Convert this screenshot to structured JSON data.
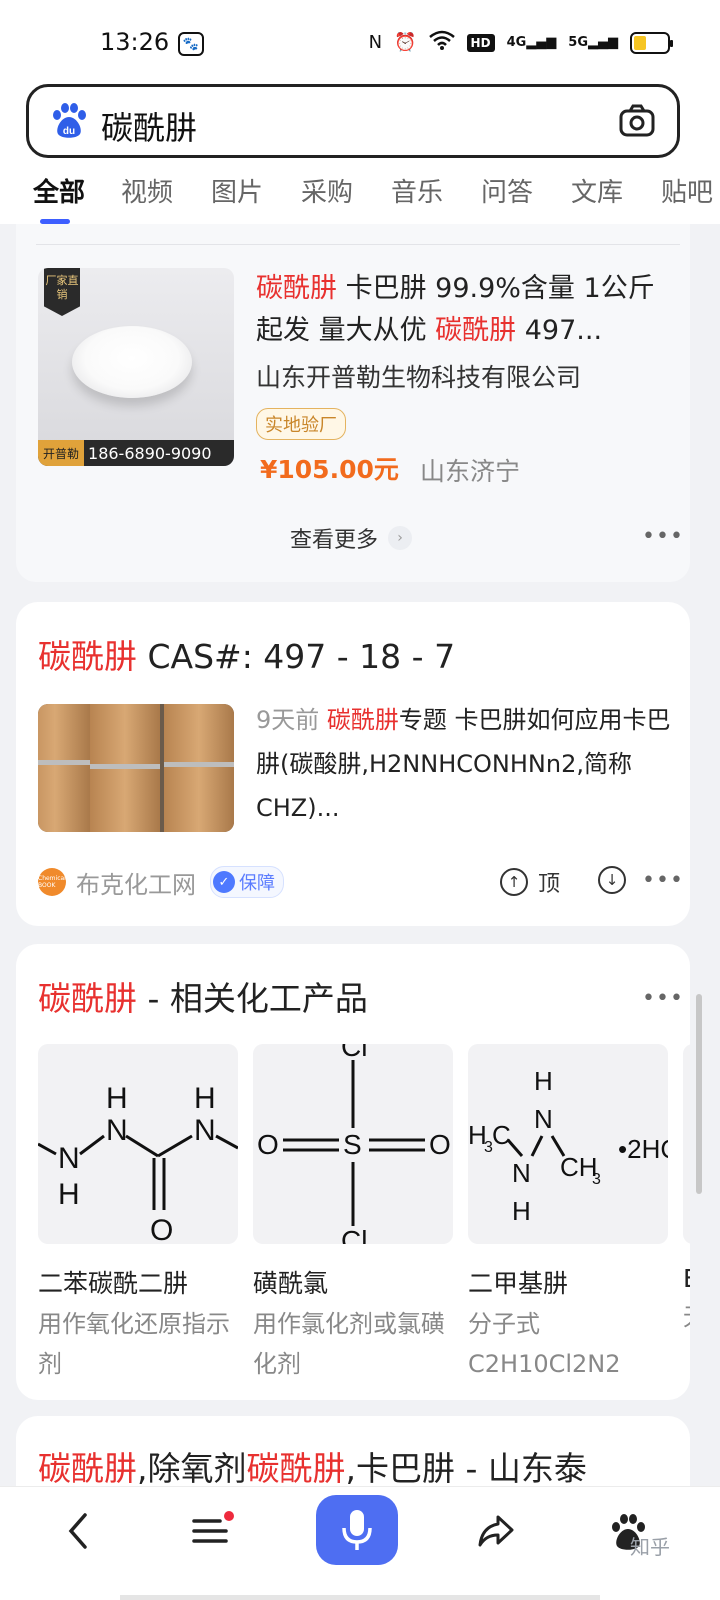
{
  "status_bar": {
    "time": "13:26",
    "network_5g": "5G",
    "network_4g": "4G",
    "hd_label": "HD"
  },
  "search": {
    "query": "碳酰肼"
  },
  "tabs": [
    "全部",
    "视频",
    "图片",
    "采购",
    "音乐",
    "问答",
    "文库",
    "贴吧"
  ],
  "shopping_card": {
    "image_badge": "厂家直销",
    "image_brand": "开普勒",
    "image_phone": "186-6890-9090",
    "title_kw1": "碳酰肼",
    "title_mid": " 卡巴肼 99.9%含量 1公斤起发 量大从优 ",
    "title_kw2": "碳酰肼",
    "title_tail": " 497...",
    "company": "山东开普勒生物科技有限公司",
    "verify_tag": "实地验厂",
    "price": "¥105.00元",
    "location": "山东济宁",
    "more_label": "查看更多"
  },
  "result_card": {
    "title_kw": "碳酰肼",
    "title_rest": " CAS#: 497 - 18 - 7",
    "time": "9天前",
    "snippet_kw": "碳酰肼",
    "snippet_rest": "专题 卡巴肼如何应用卡巴肼(碳酸肼,H2NNHCONHNn2,简称CHZ)...",
    "source_name": "布克化工网",
    "source_logo_text": "Chemical BOOK",
    "guard_label": "保障",
    "vote_up_label": "顶"
  },
  "related_card": {
    "title_kw": "碳酰肼",
    "title_rest": " - 相关化工产品",
    "products": [
      {
        "name": "二苯碳酰二肼",
        "desc": "用作氧化还原指示剂"
      },
      {
        "name": "磺酰氯",
        "desc": "用作氯化剂或氯磺化剂"
      },
      {
        "name": "二甲基肼",
        "desc": "分子式C2H10Cl2N2"
      },
      {
        "name": "E",
        "desc": "无"
      }
    ]
  },
  "next_card": {
    "kw1": "碳酰肼",
    "mid": ",除氧剂",
    "kw2": "碳酰肼",
    "tail": ",卡巴肼 - 山东泰"
  },
  "bottom_nav": {
    "watermark": "知乎"
  },
  "colors": {
    "keyword_red": "#e8312f",
    "tab_accent": "#3d5eff",
    "price_orange": "#f26b1d",
    "mic_blue": "#4e6ef2"
  }
}
